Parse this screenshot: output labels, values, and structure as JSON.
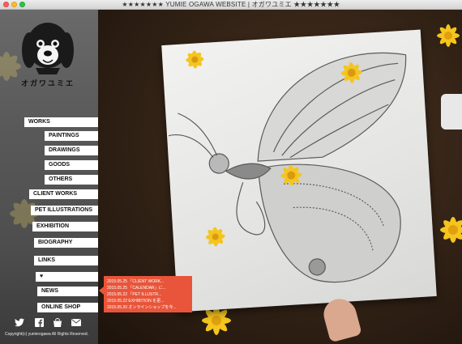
{
  "window": {
    "title": "★★★★★★★ YUMIE OGAWA WEBSITE | オガワユミエ ★★★★★★★"
  },
  "logo": {
    "text": "オガワユミエ"
  },
  "nav": {
    "works": "WORKS",
    "paintings": "PAINTINGS",
    "drawings": "DRAWINGS",
    "goods": "GOODS",
    "others": "OTHERS",
    "client_works": "CLIENT WORKS",
    "pet_illustrations": "PET ILLUSTRATIONS",
    "exhibition": "EXHIBITION",
    "biography": "BIOGRAPHY",
    "links": "LINKS",
    "heart": "♥",
    "news": "NEWS",
    "online_shop": "ONLINE SHOP"
  },
  "news_items": [
    "2015.05.25 「CLIENT WORK...",
    "2015.05.25 「CALENDAR」に...",
    "2015.05.22 「PET ILLUSTR...",
    "2015.05.22 EXHIBITION を更...",
    "2015.05.20 オンラインショップを今..."
  ],
  "social": {
    "twitter": "twitter-icon",
    "facebook": "facebook-icon",
    "shop": "shop-icon",
    "mail": "mail-icon"
  },
  "footer": {
    "copyright": "Copyright(c) yumieogawa All Rights Reserved."
  },
  "colors": {
    "news_bg": "#e8553a",
    "sidebar": "#5a5a5a",
    "nav_bg": "#ffffff"
  }
}
